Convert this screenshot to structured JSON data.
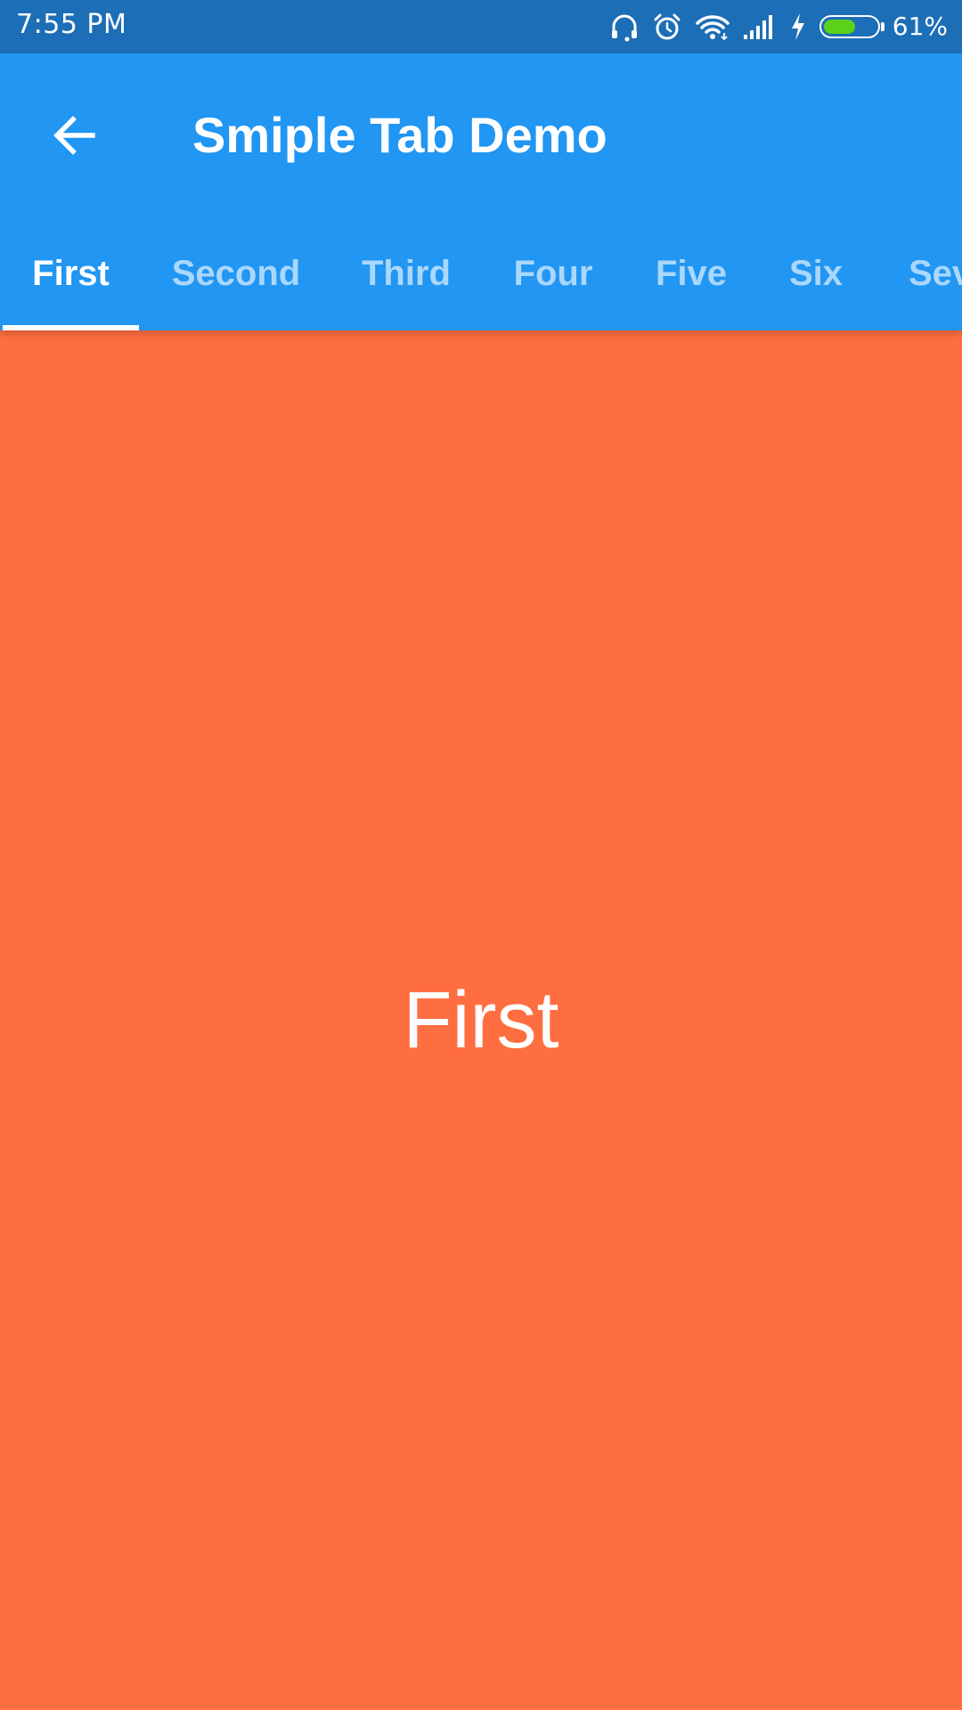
{
  "status_bar": {
    "time": "7:55 PM",
    "battery_text": "61%",
    "battery_level": 0.61,
    "icons": [
      "headset-icon",
      "alarm-icon",
      "wifi-icon",
      "signal-icon",
      "charging-icon",
      "battery-icon"
    ]
  },
  "app_bar": {
    "title": "Smiple Tab Demo",
    "back_icon": "arrow-back-icon",
    "background_color": "#2196F3"
  },
  "tabs": {
    "items": [
      {
        "label": "First",
        "selected": true
      },
      {
        "label": "Second",
        "selected": false
      },
      {
        "label": "Third",
        "selected": false
      },
      {
        "label": "Four",
        "selected": false
      },
      {
        "label": "Five",
        "selected": false
      },
      {
        "label": "Six",
        "selected": false
      },
      {
        "label": "Seven",
        "selected": false
      }
    ]
  },
  "content": {
    "label": "First",
    "background_color": "#FF6E40"
  }
}
